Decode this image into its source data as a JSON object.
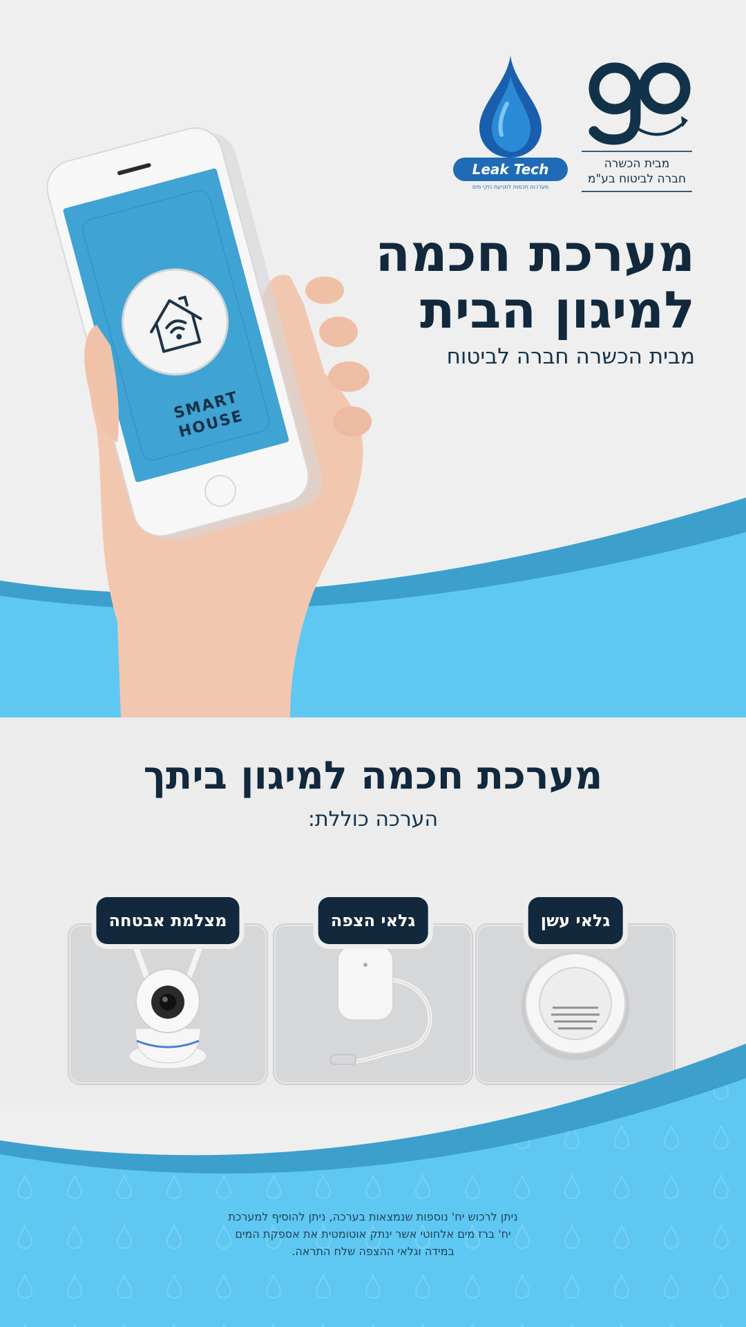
{
  "colors": {
    "background": "#efeff0",
    "navy": "#11283d",
    "sky_blue": "#5ec8f2",
    "deep_blue": "#3d9fcc",
    "brand_blue": "#1f6bb5"
  },
  "logos": {
    "go": {
      "mark": "go",
      "line1": "מבית הכשרה",
      "line2": "חברה לביטוח בע\"מ"
    },
    "leak_tech": {
      "name": "Leak Tech",
      "tagline": "מערכות חכמות למניעת נזקי מים"
    }
  },
  "hero": {
    "title_line1": "מערכת חכמה",
    "title_line2": "למיגון הבית",
    "subtitle": "מבית הכשרה חברה לביטוח",
    "phone_screen_text_line1": "SMART",
    "phone_screen_text_line2": "HOUSE",
    "phone_icon": "smart-home-wifi-icon"
  },
  "kit": {
    "title": "מערכת חכמה למיגון ביתך",
    "subtitle": "הערכה כוללת:",
    "products": [
      {
        "label": "גלאי עשן",
        "icon": "smoke-detector"
      },
      {
        "label": "גלאי הצפה",
        "icon": "flood-detector"
      },
      {
        "label": "מצלמת אבטחה",
        "icon": "security-camera"
      }
    ]
  },
  "footer_note": {
    "line1": "ניתן לרכוש יח' נוספות שנמצאות בערכה, ניתן להוסיף למערכת",
    "line2": "יח' ברז מים אלחוטי אשר ינתק אוטומטית את אספקת המים",
    "line3": "במידה וגלאי ההצפה שלח התראה."
  }
}
